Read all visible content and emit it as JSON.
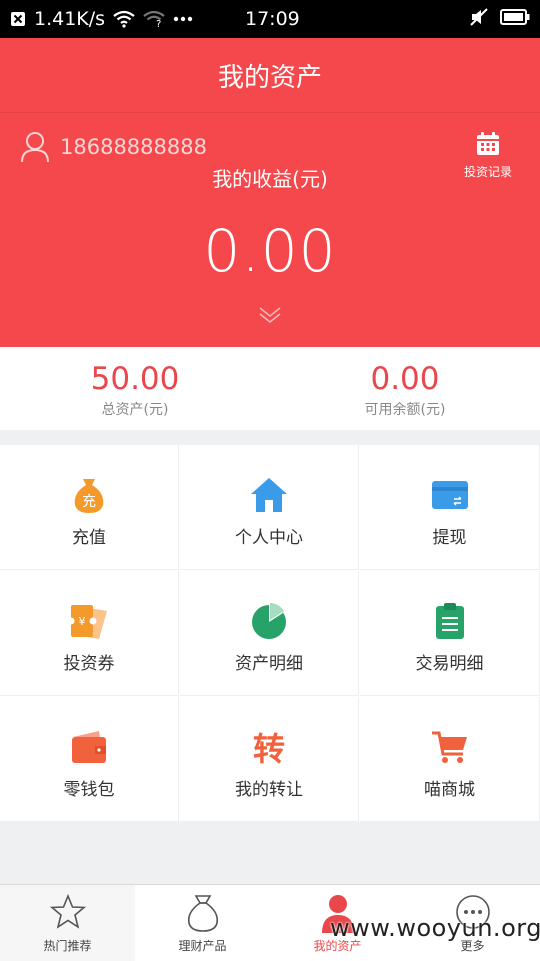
{
  "status_bar": {
    "net_speed": "1.41K/s",
    "time": "17:09"
  },
  "header": {
    "title": "我的资产"
  },
  "hero": {
    "phone": "18688888888",
    "record_label": "投资记录",
    "earnings_label": "我的收益(元)",
    "earnings_value": "0.00"
  },
  "summary": {
    "total_value": "50.00",
    "total_label": "总资产(元)",
    "available_value": "0.00",
    "available_label": "可用余额(元)"
  },
  "grid": {
    "items": [
      {
        "label": "充值",
        "icon": "money-bag-icon",
        "color": "#f39a2b"
      },
      {
        "label": "个人中心",
        "icon": "home-icon",
        "color": "#3a9be8"
      },
      {
        "label": "提现",
        "icon": "card-icon",
        "color": "#3a9be8"
      },
      {
        "label": "投资券",
        "icon": "coupon-icon",
        "color": "#f39a2b"
      },
      {
        "label": "资产明细",
        "icon": "pie-chart-icon",
        "color": "#27a36a"
      },
      {
        "label": "交易明细",
        "icon": "clipboard-icon",
        "color": "#27a36a"
      },
      {
        "label": "零钱包",
        "icon": "wallet-icon",
        "color": "#f1613c"
      },
      {
        "label": "我的转让",
        "icon": "transfer-icon",
        "color": "#f1613c",
        "glyph": "转"
      },
      {
        "label": "喵商城",
        "icon": "cart-icon",
        "color": "#f1613c"
      }
    ]
  },
  "tabbar": {
    "items": [
      {
        "label": "热门推荐",
        "icon": "star-icon"
      },
      {
        "label": "理财产品",
        "icon": "money-bag-icon"
      },
      {
        "label": "我的资产",
        "icon": "user-icon",
        "active": true
      },
      {
        "label": "更多",
        "icon": "more-icon"
      }
    ]
  },
  "watermark": "www.wooyun.org",
  "colors": {
    "brand_red": "#f4484c",
    "value_red": "#e8484c"
  }
}
